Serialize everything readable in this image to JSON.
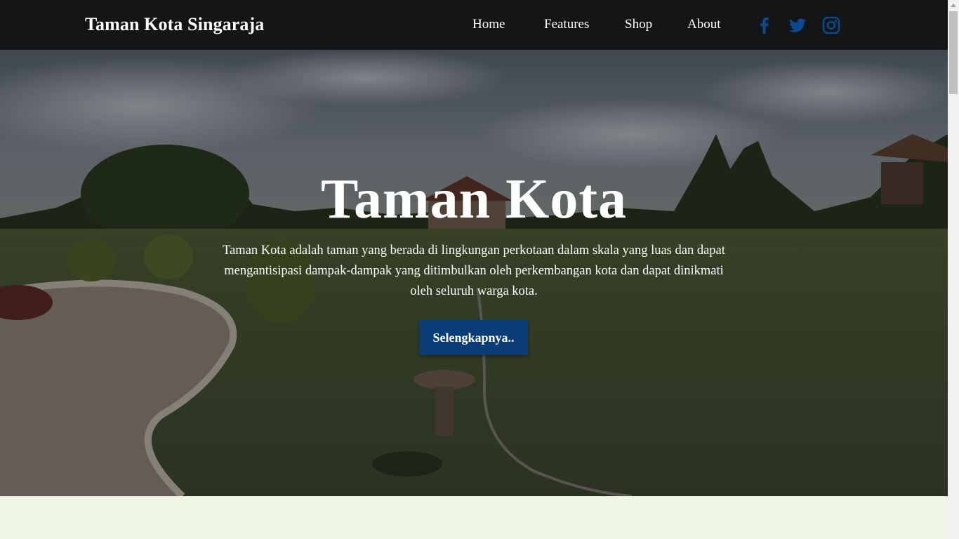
{
  "navbar": {
    "brand": "Taman Kota Singaraja",
    "links": [
      {
        "label": "Home"
      },
      {
        "label": "Features"
      },
      {
        "label": "Shop"
      },
      {
        "label": "About"
      }
    ],
    "social_icons": [
      "facebook-icon",
      "twitter-icon",
      "instagram-icon"
    ],
    "icon_color": "#0b4a8f",
    "background": "#141516"
  },
  "hero": {
    "title": "Taman Kota",
    "description": "Taman Kota adalah taman yang berada di lingkungan perkotaan dalam skala yang luas dan dapat mengantisipasi dampak-dampak yang ditimbulkan oleh perkembangan kota dan dapat dinikmati oleh seluruh warga kota.",
    "button_label": "Selengkapnya..",
    "button_color": "#0a3d78"
  },
  "page": {
    "section_background": "#eef5e2"
  }
}
